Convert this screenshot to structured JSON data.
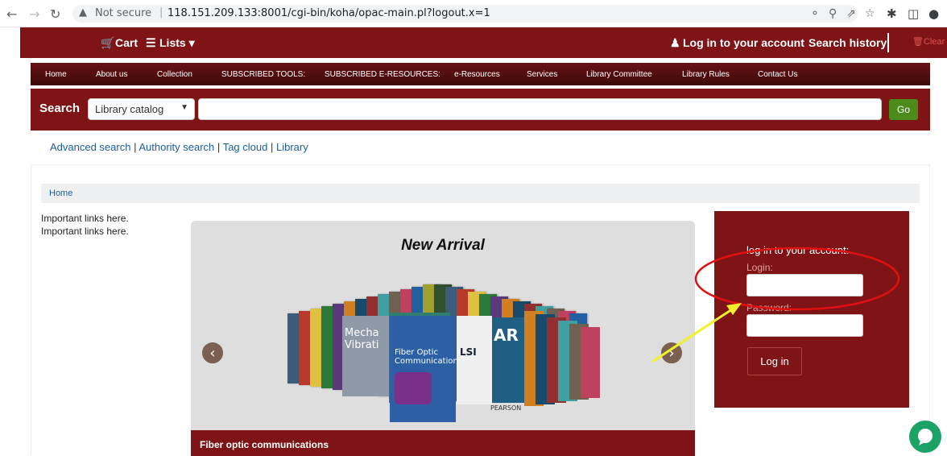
{
  "browser": {
    "not_secure": "Not secure",
    "url": "118.151.209.133:8001/cgi-bin/koha/opac-main.pl?logout.x=1"
  },
  "topbar": {
    "cart": "Cart",
    "lists": "Lists",
    "login_link": "Log in to your account",
    "search_history": "Search history",
    "clear": "Clear"
  },
  "menu": [
    "Home",
    "About us",
    "Collection",
    "SUBSCRIBED TOOLS:",
    "SUBSCRIBED E-RESOURCES:",
    "e-Resources",
    "Services",
    "Library Committee",
    "Library Rules",
    "Contact Us"
  ],
  "search": {
    "label": "Search",
    "scope": "Library catalog",
    "go": "Go"
  },
  "more_searches": [
    "Advanced search",
    "Authority search",
    "Tag cloud",
    "Library"
  ],
  "breadcrumb": "Home",
  "important_links": [
    "Important links here.",
    "Important links here."
  ],
  "carousel": {
    "title": "New Arrival",
    "caption": "Fiber optic communications",
    "cover_text": [
      "Fiber Optic",
      "Communications",
      "Mecha",
      "Vibrati",
      "LSI",
      "AR",
      "PEARSON"
    ]
  },
  "login": {
    "title": "log in to your account:",
    "login_label": "Login:",
    "password_label": "Password:",
    "button": "Log in"
  },
  "colors": {
    "brand": "#7f1416",
    "go_button": "#4c8a1c",
    "annotation_circle": "#e01010",
    "annotation_arrow": "#f2f22a"
  }
}
